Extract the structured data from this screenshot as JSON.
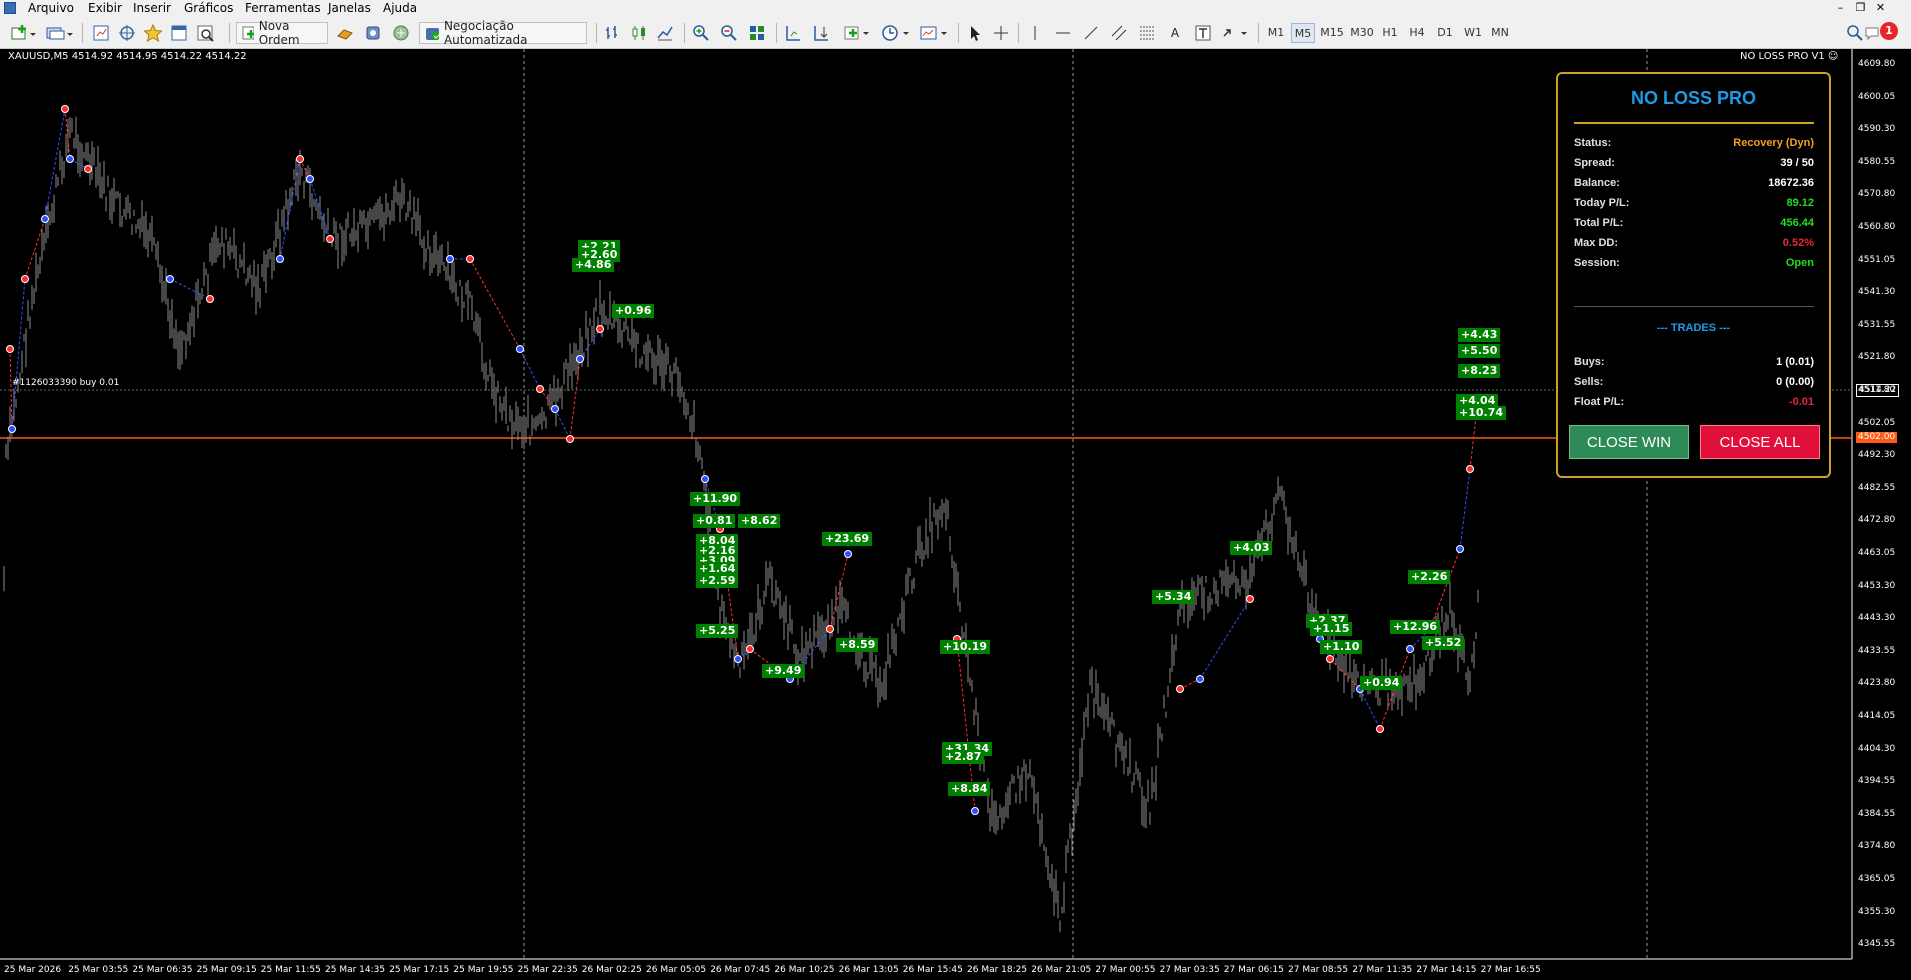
{
  "menu": {
    "items": [
      "Arquivo",
      "Exibir",
      "Inserir",
      "Gráficos",
      "Ferramentas",
      "Janelas",
      "Ajuda"
    ]
  },
  "toolbar": {
    "new_order": "Nova Ordem",
    "algo_trading": "Negociação Automatizada",
    "timeframes": [
      "M1",
      "M5",
      "M15",
      "M30",
      "H1",
      "H4",
      "D1",
      "W1",
      "MN"
    ],
    "active_timeframe": "M5",
    "notification_count": "1"
  },
  "chart": {
    "header": "XAUUSD,M5  4514.92 4514.95 4514.22 4514.22",
    "brand": "NO LOSS PRO V1",
    "order_line_label": "#1126033390 buy 0.01",
    "current_price": "4514.22",
    "stop_price": "4502.00",
    "price_ticks": [
      "4609.80",
      "4600.05",
      "4590.30",
      "4580.55",
      "4570.80",
      "4560.80",
      "4551.05",
      "4541.30",
      "4531.55",
      "4521.80",
      "4511.80",
      "4502.05",
      "4492.30",
      "4482.55",
      "4472.80",
      "4463.05",
      "4453.30",
      "4443.30",
      "4433.55",
      "4423.80",
      "4414.05",
      "4404.30",
      "4394.55",
      "4384.55",
      "4374.80",
      "4365.05",
      "4355.30",
      "4345.55"
    ],
    "time_ticks": [
      "25 Mar 2026",
      "25 Mar 03:55",
      "25 Mar 06:35",
      "25 Mar 09:15",
      "25 Mar 11:55",
      "25 Mar 14:35",
      "25 Mar 17:15",
      "25 Mar 19:55",
      "25 Mar 22:35",
      "26 Mar 02:25",
      "26 Mar 05:05",
      "26 Mar 07:45",
      "26 Mar 10:25",
      "26 Mar 13:05",
      "26 Mar 15:45",
      "26 Mar 18:25",
      "26 Mar 21:05",
      "27 Mar 00:55",
      "27 Mar 03:35",
      "27 Mar 06:15",
      "27 Mar 08:55",
      "27 Mar 11:35",
      "27 Mar 14:15",
      "27 Mar 16:55"
    ],
    "profit_tags": [
      "+2.21",
      "+2.60",
      "+4.86",
      "+0.96",
      "+11.90",
      "+0.81",
      "+8.62",
      "+8.04",
      "+2.16",
      "+3.09",
      "+1.64",
      "+2.59",
      "+5.25",
      "+9.49",
      "+23.69",
      "+8.59",
      "+10.19",
      "+31.34",
      "+2.87",
      "+8.84",
      "+5.34",
      "+4.03",
      "+2.37",
      "+1.15",
      "+1.10",
      "+0.94",
      "+12.96",
      "+2.26",
      "+5.52",
      "+4.43",
      "+5.50",
      "+8.23",
      "+4.04",
      "+10.74"
    ]
  },
  "panel": {
    "title": "NO LOSS PRO",
    "rows": [
      {
        "label": "Status:",
        "value": "Recovery (Dyn)",
        "color": "#f0a020"
      },
      {
        "label": "Spread:",
        "value": "39 / 50",
        "color": "#ffffff"
      },
      {
        "label": "Balance:",
        "value": "18672.36",
        "color": "#ffffff"
      },
      {
        "label": "Today P/L:",
        "value": "89.12",
        "color": "#22dd22"
      },
      {
        "label": "Total P/L:",
        "value": "456.44",
        "color": "#22dd22"
      },
      {
        "label": "Max DD:",
        "value": "0.52%",
        "color": "#e8253a"
      },
      {
        "label": "Session:",
        "value": "Open",
        "color": "#22dd22"
      }
    ],
    "trades_header": "--- TRADES ---",
    "trade_rows": [
      {
        "label": "Buys:",
        "value": "1 (0.01)",
        "color": "#ffffff"
      },
      {
        "label": "Sells:",
        "value": "0 (0.00)",
        "color": "#ffffff"
      },
      {
        "label": "Float P/L:",
        "value": "-0.01",
        "color": "#e8253a"
      }
    ],
    "close_win_label": "CLOSE WIN",
    "close_all_label": "CLOSE ALL"
  }
}
